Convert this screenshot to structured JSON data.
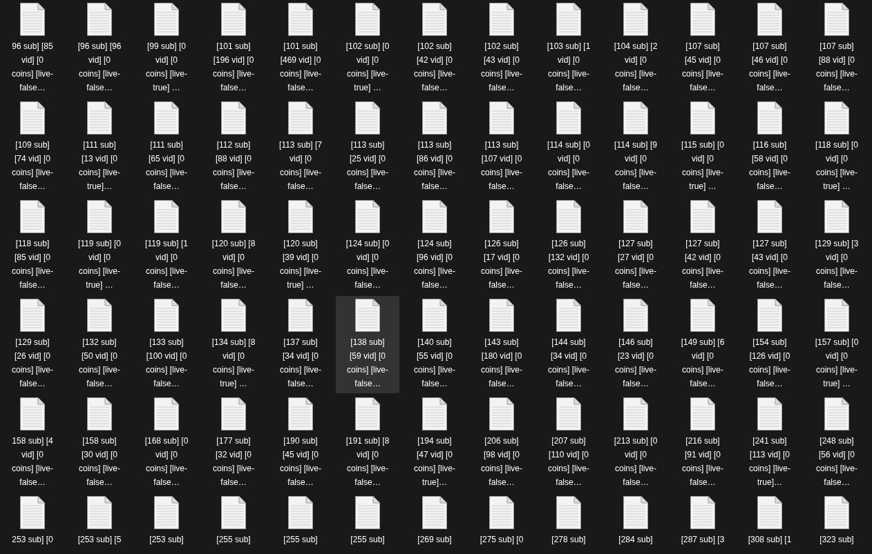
{
  "files": [
    {
      "label": "96 sub] [85 vid] [0 coins] [live-false…",
      "selected": false
    },
    {
      "label": "[96 sub] [96 vid] [0 coins] [live-false…",
      "selected": false
    },
    {
      "label": "[99 sub] [0 vid] [0 coins] [live-true] …",
      "selected": false
    },
    {
      "label": "[101 sub] [196 vid] [0 coins] [live-false…",
      "selected": false
    },
    {
      "label": "[101 sub] [469 vid] [0 coins] [live-false…",
      "selected": false
    },
    {
      "label": "[102 sub] [0 vid] [0 coins] [live-true] …",
      "selected": false
    },
    {
      "label": "[102 sub] [42 vid] [0 coins] [live-false…",
      "selected": false
    },
    {
      "label": "[102 sub] [43 vid] [0 coins] [live-false…",
      "selected": false
    },
    {
      "label": "[103 sub] [1 vid] [0 coins] [live-false…",
      "selected": false
    },
    {
      "label": "[104 sub] [2 vid] [0 coins] [live-false…",
      "selected": false
    },
    {
      "label": "[107 sub] [45 vid] [0 coins] [live-false…",
      "selected": false
    },
    {
      "label": "[107 sub] [46 vid] [0 coins] [live-false…",
      "selected": false
    },
    {
      "label": "[107 sub] [88 vid] [0 coins] [live-false…",
      "selected": false
    },
    {
      "label": "[109 sub] [74 vid] [0 coins] [live-false…",
      "selected": false
    },
    {
      "label": "[111 sub] [13 vid] [0 coins] [live-true]…",
      "selected": false
    },
    {
      "label": "[111 sub] [65 vid] [0 coins] [live-false…",
      "selected": false
    },
    {
      "label": "[112 sub] [88 vid] [0 coins] [live-false…",
      "selected": false
    },
    {
      "label": "[113 sub] [7 vid] [0 coins] [live-false…",
      "selected": false
    },
    {
      "label": "[113 sub] [25 vid] [0 coins] [live-false…",
      "selected": false
    },
    {
      "label": "[113 sub] [86 vid] [0 coins] [live-false…",
      "selected": false
    },
    {
      "label": "[113 sub] [107 vid] [0 coins] [live-false…",
      "selected": false
    },
    {
      "label": "[114 sub] [0 vid] [0 coins] [live-false…",
      "selected": false
    },
    {
      "label": "[114 sub] [9 vid] [0 coins] [live-false…",
      "selected": false
    },
    {
      "label": "[115 sub] [0 vid] [0 coins] [live-true] …",
      "selected": false
    },
    {
      "label": "[116 sub] [58 vid] [0 coins] [live-false…",
      "selected": false
    },
    {
      "label": "[118 sub] [0 vid] [0 coins] [live-true] …",
      "selected": false
    },
    {
      "label": "[118 sub] [85 vid] [0 coins] [live-false…",
      "selected": false
    },
    {
      "label": "[119 sub] [0 vid] [0 coins] [live-true] …",
      "selected": false
    },
    {
      "label": "[119 sub] [1 vid] [0 coins] [live-false…",
      "selected": false
    },
    {
      "label": "[120 sub] [8 vid] [0 coins] [live-false…",
      "selected": false
    },
    {
      "label": "[120 sub] [39 vid] [0 coins] [live-true] …",
      "selected": false
    },
    {
      "label": "[124 sub] [0 vid] [0 coins] [live-false…",
      "selected": false
    },
    {
      "label": "[124 sub] [96 vid] [0 coins] [live-false…",
      "selected": false
    },
    {
      "label": "[126 sub] [17 vid] [0 coins] [live-false…",
      "selected": false
    },
    {
      "label": "[126 sub] [132 vid] [0 coins] [live-false…",
      "selected": false
    },
    {
      "label": "[127 sub] [27 vid] [0 coins] [live-false…",
      "selected": false
    },
    {
      "label": "[127 sub] [42 vid] [0 coins] [live-false…",
      "selected": false
    },
    {
      "label": "[127 sub] [43 vid] [0 coins] [live-false…",
      "selected": false
    },
    {
      "label": "[129 sub] [3 vid] [0 coins] [live-false…",
      "selected": false
    },
    {
      "label": "[129 sub] [26 vid] [0 coins] [live-false…",
      "selected": false
    },
    {
      "label": "[132 sub] [50 vid] [0 coins] [live-false…",
      "selected": false
    },
    {
      "label": "[133 sub] [100 vid] [0 coins] [live-false…",
      "selected": false
    },
    {
      "label": "[134 sub] [8 vid] [0 coins] [live-true] …",
      "selected": false
    },
    {
      "label": "[137 sub] [34 vid] [0 coins] [live-false…",
      "selected": false
    },
    {
      "label": "[138 sub] [59 vid] [0 coins] [live-false…",
      "selected": true
    },
    {
      "label": "[140 sub] [55 vid] [0 coins] [live-false…",
      "selected": false
    },
    {
      "label": "[143 sub] [180 vid] [0 coins] [live-false…",
      "selected": false
    },
    {
      "label": "[144 sub] [34 vid] [0 coins] [live-false…",
      "selected": false
    },
    {
      "label": "[146 sub] [23 vid] [0 coins] [live-false…",
      "selected": false
    },
    {
      "label": "[149 sub] [6 vid] [0 coins] [live-false…",
      "selected": false
    },
    {
      "label": "[154 sub] [126 vid] [0 coins] [live-false…",
      "selected": false
    },
    {
      "label": "[157 sub] [0 vid] [0 coins] [live-true] …",
      "selected": false
    },
    {
      "label": "158 sub] [4 vid] [0 coins] [live-false…",
      "selected": false
    },
    {
      "label": "[158 sub] [30 vid] [0 coins] [live-false…",
      "selected": false
    },
    {
      "label": "[168 sub] [0 vid] [0 coins] [live-false…",
      "selected": false
    },
    {
      "label": "[177 sub] [32 vid] [0 coins] [live-false…",
      "selected": false
    },
    {
      "label": "[190 sub] [45 vid] [0 coins] [live-false…",
      "selected": false
    },
    {
      "label": "[191 sub] [8 vid] [0 coins] [live-false…",
      "selected": false
    },
    {
      "label": "[194 sub] [47 vid] [0 coins] [live-true]…",
      "selected": false
    },
    {
      "label": "[206 sub] [98 vid] [0 coins] [live-false…",
      "selected": false
    },
    {
      "label": "[207 sub] [110 vid] [0 coins] [live-false…",
      "selected": false
    },
    {
      "label": "[213 sub] [0 vid] [0 coins] [live-false…",
      "selected": false
    },
    {
      "label": "[216 sub] [91 vid] [0 coins] [live-false…",
      "selected": false
    },
    {
      "label": "[241 sub] [113 vid] [0 coins] [live-true]…",
      "selected": false
    },
    {
      "label": "[248 sub] [56 vid] [0 coins] [live-false…",
      "selected": false
    },
    {
      "label": "253 sub] [0",
      "selected": false
    },
    {
      "label": "[253 sub] [5",
      "selected": false
    },
    {
      "label": "[253 sub]",
      "selected": false
    },
    {
      "label": "[255 sub]",
      "selected": false
    },
    {
      "label": "[255 sub]",
      "selected": false
    },
    {
      "label": "[255 sub]",
      "selected": false
    },
    {
      "label": "[269 sub]",
      "selected": false
    },
    {
      "label": "[275 sub] [0",
      "selected": false
    },
    {
      "label": "[278 sub]",
      "selected": false
    },
    {
      "label": "[284 sub]",
      "selected": false
    },
    {
      "label": "[287 sub] [3",
      "selected": false
    },
    {
      "label": "[308 sub] [1",
      "selected": false
    },
    {
      "label": "[323 sub]",
      "selected": false
    }
  ]
}
